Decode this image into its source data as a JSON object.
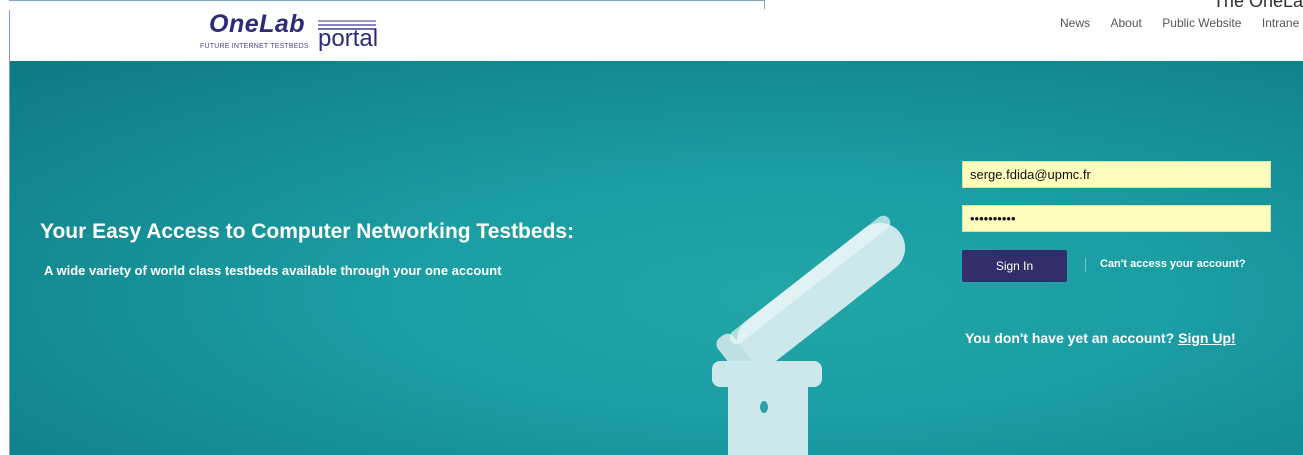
{
  "window": {
    "cutoff_title": "The OneLa"
  },
  "header": {
    "logo": {
      "main": "OneLab",
      "sub": "FUTURE INTERNET TESTBEDS",
      "portal": "portal"
    },
    "nav": [
      "News",
      "About",
      "Public Website",
      "Intrane"
    ]
  },
  "hero": {
    "tagline": "Your Easy Access to Computer Networking Testbeds:",
    "subtagline": "A wide variety of world class testbeds available through your one account"
  },
  "login": {
    "email_value": "serge.fdida@upmc.fr",
    "password_value": "••••••••••",
    "signin_label": "Sign In",
    "cant_access": "Can't access your account?",
    "no_account_text": "You don't have yet an account?",
    "signup_label": "Sign Up!"
  },
  "colors": {
    "hero_teal": "#1b9ea4",
    "input_yellow": "#fffebe",
    "button_purple": "#332d6c",
    "logo_navy": "#2e2a77"
  }
}
